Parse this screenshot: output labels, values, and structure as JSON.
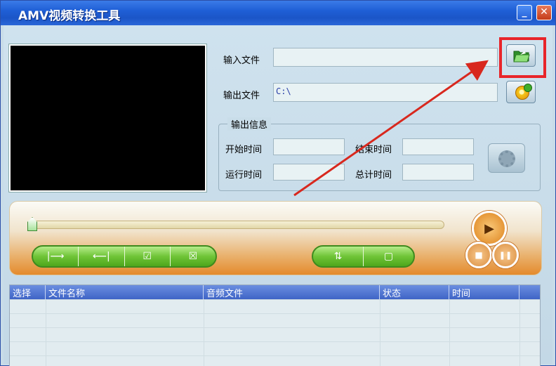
{
  "window": {
    "title": "AMV视频转换工具",
    "minimize_glyph": "_",
    "close_glyph": "✕"
  },
  "files": {
    "input_label": "输入文件",
    "input_value": "",
    "output_label": "输出文件",
    "output_value": "C:\\"
  },
  "info": {
    "group_title": "输出信息",
    "start_label": "开始时间",
    "end_label": "结束时间",
    "run_label": "运行时间",
    "total_label": "总计时间"
  },
  "player": {
    "edit_buttons": [
      "|⟶",
      "⟵|",
      "☑",
      "☒"
    ],
    "convert_buttons": [
      "⇅",
      "▢"
    ],
    "play_glyph": "▶",
    "stop_glyph": "■",
    "pause_glyph": "❚❚"
  },
  "table": {
    "headers": [
      "选择",
      "文件名称",
      "音频文件",
      "状态",
      "时间"
    ]
  },
  "colors": {
    "titlebar": "#1f5fd6",
    "highlight": "#e8252a",
    "annotation_arrow": "#d8281e",
    "player_orange": "#e48a2c",
    "pill_green": "#6fc437"
  },
  "icons": {
    "browse_input": "folder-open-icon",
    "browse_output": "disc-icon",
    "settings": "gear-icon"
  }
}
